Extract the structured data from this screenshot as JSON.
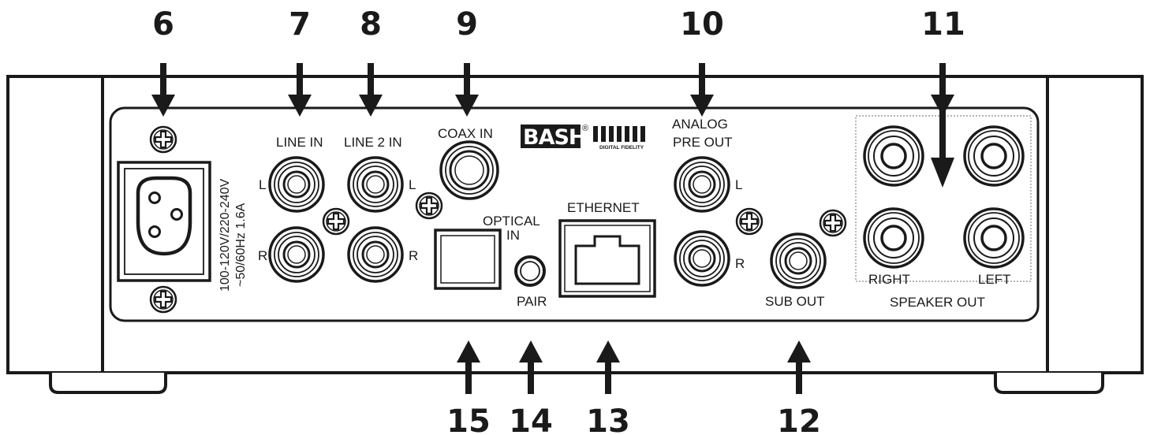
{
  "callouts": {
    "n6": "6",
    "n7": "7",
    "n8": "8",
    "n9": "9",
    "n10": "10",
    "n11": "11",
    "n12": "12",
    "n13": "13",
    "n14": "14",
    "n15": "15"
  },
  "labels": {
    "line_in": "LINE IN",
    "line2_in": "LINE 2 IN",
    "coax_in": "COAX IN",
    "analog": "ANALOG",
    "pre_out": "PRE OUT",
    "optical": "OPTICAL",
    "optical_in": "IN",
    "ethernet": "ETHERNET",
    "pair": "PAIR",
    "sub_out": "SUB OUT",
    "right": "RIGHT",
    "left": "LEFT",
    "speaker_out": "SPEAKER OUT",
    "ch_l": "L",
    "ch_r": "R",
    "power_line1": "100-120V/220-240V",
    "power_line2": "~50/60Hz 1.6A"
  },
  "brand": {
    "name": "BASH",
    "mark": "®",
    "tagline": "DIGITAL FIDELITY"
  }
}
